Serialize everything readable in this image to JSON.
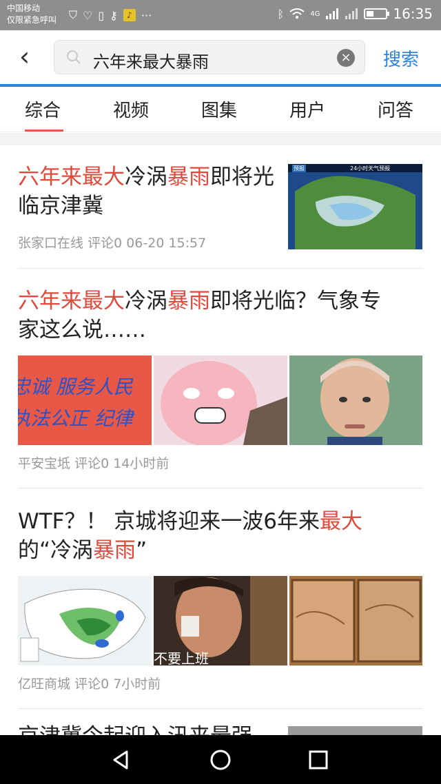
{
  "status_bar": {
    "carrier": "中国移动",
    "emergency": "仅限紧急呼叫",
    "network": "4G",
    "time": "16:35"
  },
  "search": {
    "query": "六年来最大暴雨",
    "button": "搜索"
  },
  "tabs": [
    "综合",
    "视频",
    "图集",
    "用户",
    "问答"
  ],
  "results": [
    {
      "title_parts": [
        "六年来最大",
        "冷涡",
        "暴雨",
        "即将",
        "光临京津冀"
      ],
      "source": "张家口在线",
      "comments": "评论0",
      "time": "06-20 15:57",
      "thumb_text": [
        "预报",
        "24小时天气预报"
      ]
    },
    {
      "title_parts": [
        "六年来最大",
        "冷涡",
        "暴雨",
        "即将光临？气象专",
        "家这么说……"
      ],
      "source": "平安宝坻",
      "comments": "评论0",
      "time": "14小时前",
      "thumb_text": [
        "忠诚  服务人民",
        "执法公正  纪律"
      ]
    },
    {
      "title_parts": [
        "WTF？！ 京城将迎来一波6年来",
        "最大",
        "的“冷涡",
        "暴雨",
        "”"
      ],
      "source": "亿旺商城",
      "comments": "评论0",
      "time": "7小时前",
      "thumb_text": [
        "不要上班"
      ]
    },
    {
      "title_partial": "京津冀今起迎入汛来最强"
    }
  ],
  "colors": {
    "accent_blue": "#2d83d9",
    "highlight_red": "#e0493c",
    "status_bar_gray": "#8e8e8e"
  }
}
